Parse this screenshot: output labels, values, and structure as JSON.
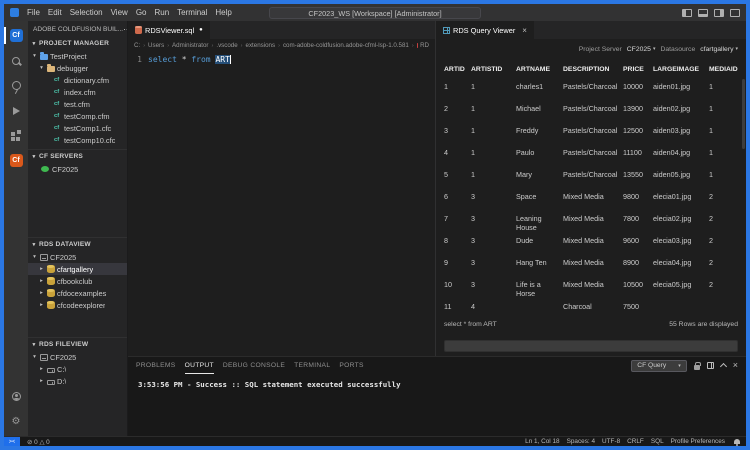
{
  "titlebar": {
    "menus": [
      "File",
      "Edit",
      "Selection",
      "View",
      "Go",
      "Run",
      "Terminal",
      "Help"
    ],
    "title": "CF2023_WS [Workspace] [Administrator]"
  },
  "activity_bar": {
    "cf_glyph": "Cf",
    "icons": [
      "coldfusion-builder",
      "search",
      "source-control",
      "run-and-debug",
      "extensions",
      "coldfusion-server",
      "account",
      "settings"
    ]
  },
  "sidebar": {
    "title": "ADOBE COLDFUSION BUIL...",
    "sections": [
      {
        "label": "PROJECT MANAGER",
        "items": [
          {
            "label": "TestProject",
            "depth": 0,
            "chevron": "down",
            "icon": "folder-blue"
          },
          {
            "label": "debugger",
            "depth": 1,
            "chevron": "down",
            "icon": "folder"
          },
          {
            "label": "dictionary.cfm",
            "depth": 2,
            "chevron": null,
            "icon": "cfml"
          },
          {
            "label": "index.cfm",
            "depth": 2,
            "chevron": null,
            "icon": "cfml"
          },
          {
            "label": "test.cfm",
            "depth": 2,
            "chevron": null,
            "icon": "cfml"
          },
          {
            "label": "testComp.cfm",
            "depth": 2,
            "chevron": null,
            "icon": "cfml"
          },
          {
            "label": "testComp1.cfc",
            "depth": 2,
            "chevron": null,
            "icon": "cfml"
          },
          {
            "label": "testComp10.cfc",
            "depth": 2,
            "chevron": null,
            "icon": "cfml"
          }
        ]
      },
      {
        "label": "CF SERVERS",
        "items": [
          {
            "label": "CF2025",
            "depth": 0,
            "chevron": null,
            "icon": "server-online"
          }
        ]
      },
      {
        "label": "RDS DATAVIEW",
        "items": [
          {
            "label": "CF2025",
            "depth": 0,
            "chevron": "down",
            "icon": "server"
          },
          {
            "label": "cfartgallery",
            "depth": 1,
            "chevron": "right",
            "icon": "database",
            "selected": true
          },
          {
            "label": "cfbookclub",
            "depth": 1,
            "chevron": "right",
            "icon": "database"
          },
          {
            "label": "cfdocexamples",
            "depth": 1,
            "chevron": "right",
            "icon": "database"
          },
          {
            "label": "cfcodeexplorer",
            "depth": 1,
            "chevron": "right",
            "icon": "database"
          }
        ]
      },
      {
        "label": "RDS FILEVIEW",
        "items": [
          {
            "label": "CF2025",
            "depth": 0,
            "chevron": "down",
            "icon": "server"
          },
          {
            "label": "C:\\",
            "depth": 1,
            "chevron": "right",
            "icon": "drive"
          },
          {
            "label": "D:\\",
            "depth": 1,
            "chevron": "right",
            "icon": "drive"
          }
        ]
      }
    ]
  },
  "editor": {
    "tab": {
      "label": "RDSViewer.sql",
      "modified": true
    },
    "breadcrumbs": [
      "C:",
      "Users",
      "Administrator",
      ".vscode",
      "extensions",
      "com-adobe-coldfusion.adobe-cfml-lsp-1.0.581",
      "RD"
    ],
    "code": {
      "line_number": "1",
      "tokens": [
        {
          "text": "select",
          "type": "keyword"
        },
        {
          "text": " * ",
          "type": "plain"
        },
        {
          "text": "from",
          "type": "keyword"
        },
        {
          "text": " ",
          "type": "plain"
        },
        {
          "text": "ART",
          "type": "selected"
        }
      ]
    }
  },
  "rds_panel": {
    "tab": "RDS Query Viewer",
    "toolbar": {
      "server_label": "Project Server",
      "server_value": "CF2025",
      "datasource_label": "Datasource",
      "datasource_value": "cfartgallery"
    },
    "table": {
      "columns": [
        "ARTID",
        "ARTISTID",
        "ARTNAME",
        "DESCRIPTION",
        "PRICE",
        "LARGEIMAGE",
        "MEDIAID"
      ],
      "rows": [
        [
          "1",
          "1",
          "charles1",
          "Pastels/Charcoal",
          "10000",
          "aiden01.jpg",
          "1"
        ],
        [
          "2",
          "1",
          "Michael",
          "Pastels/Charcoal",
          "13900",
          "aiden02.jpg",
          "1"
        ],
        [
          "3",
          "1",
          "Freddy",
          "Pastels/Charcoal",
          "12500",
          "aiden03.jpg",
          "1"
        ],
        [
          "4",
          "1",
          "Paulo",
          "Pastels/Charcoal",
          "11100",
          "aiden04.jpg",
          "1"
        ],
        [
          "5",
          "1",
          "Mary",
          "Pastels/Charcoal",
          "13550",
          "aiden05.jpg",
          "1"
        ],
        [
          "6",
          "3",
          "Space",
          "Mixed Media",
          "9800",
          "elecia01.jpg",
          "2"
        ],
        [
          "7",
          "3",
          "Leaning House",
          "Mixed Media",
          "7800",
          "elecia02.jpg",
          "2"
        ],
        [
          "8",
          "3",
          "Dude",
          "Mixed Media",
          "9600",
          "elecia03.jpg",
          "2"
        ],
        [
          "9",
          "3",
          "Hang Ten",
          "Mixed Media",
          "8900",
          "elecia04.jpg",
          "2"
        ],
        [
          "10",
          "3",
          "Life is a Horse",
          "Mixed Media",
          "10500",
          "elecia05.jpg",
          "2"
        ],
        [
          "11",
          "4",
          "",
          "Charcoal",
          "7500",
          "",
          ""
        ]
      ]
    },
    "footer": {
      "query": "select * from ART",
      "rows_info": "55 Rows are displayed"
    },
    "query_input": {
      "value": "",
      "placeholder": ""
    }
  },
  "bottom_panel": {
    "tabs": [
      "PROBLEMS",
      "OUTPUT",
      "DEBUG CONSOLE",
      "TERMINAL",
      "PORTS"
    ],
    "active_tab": "OUTPUT",
    "channel": "CF Query",
    "output_line": "3:53:56 PM - Success :: SQL statement executed successfully"
  },
  "statusbar": {
    "errors": "0",
    "warnings": "0",
    "right": [
      "Ln 1, Col 18",
      "Spaces: 4",
      "UTF-8",
      "CRLF",
      "SQL",
      "Profile Preferences"
    ]
  }
}
